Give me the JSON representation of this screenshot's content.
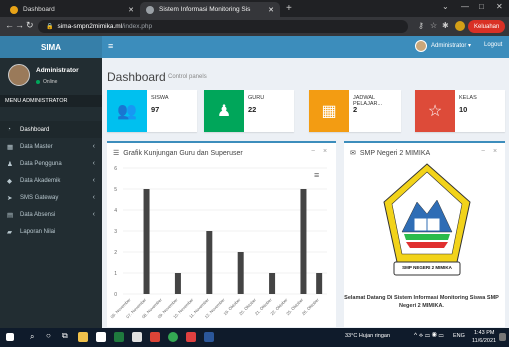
{
  "browser": {
    "tabs": [
      {
        "title": "Dashboard",
        "icon": "globe-icon",
        "active": false
      },
      {
        "title": "Sistem Informasi Monitoring Sis",
        "icon": "globe-icon",
        "active": true
      }
    ],
    "url_host": "sima-smpn2mimika.ml",
    "url_path": "/index.php",
    "profile_label": "Keluahan"
  },
  "header": {
    "logo": "SIMA",
    "user": "Administrator ▾",
    "logout": "Logout"
  },
  "sidebar": {
    "name": "Administrator",
    "status": "Online",
    "menu_header": "MENU ADMINISTRATOR",
    "items": [
      {
        "label": "Dashboard",
        "icon": "dashboard-icon",
        "chevron": false
      },
      {
        "label": "Data Master",
        "icon": "table-icon",
        "chevron": true
      },
      {
        "label": "Data Pengguna",
        "icon": "user-icon",
        "chevron": true
      },
      {
        "label": "Data Akademik",
        "icon": "tag-icon",
        "chevron": true
      },
      {
        "label": "SMS Gateway",
        "icon": "send-icon",
        "chevron": true
      },
      {
        "label": "Data Absensi",
        "icon": "grid-icon",
        "chevron": true
      },
      {
        "label": "Laporan Nilai",
        "icon": "book-icon",
        "chevron": false
      }
    ]
  },
  "content": {
    "title": "Dashboard",
    "subtitle": "Control panels"
  },
  "stats": [
    {
      "label": "SISWA",
      "value": "97",
      "color": "#00c0ef",
      "icon": "users-icon"
    },
    {
      "label": "GURU",
      "value": "22",
      "color": "#00a65a",
      "icon": "user-icon"
    },
    {
      "label": "JADWAL PELAJAR...",
      "value": "2",
      "color": "#f39c12",
      "icon": "calendar-icon"
    },
    {
      "label": "KELAS",
      "value": "10",
      "color": "#dd4b39",
      "icon": "star-icon"
    }
  ],
  "chart_panel": {
    "title": "Grafik Kunjungan Guru dan Superuser",
    "tools": [
      "−",
      "×"
    ]
  },
  "school_panel": {
    "title": "SMP Negeri 2 MIMIKA",
    "tools": [
      "−",
      "×"
    ],
    "logo_text": "SMP NEGERI 2 MIMIKA",
    "welcome": "Selamat Datang Di Sistem Informasi Monitoring Siswa SMP Negeri 2 MIMIKA."
  },
  "chart_data": {
    "type": "bar",
    "categories": [
      "06. November",
      "07. November",
      "08. November",
      "09. November",
      "10. November",
      "11. November",
      "12. November",
      "19. Oktober",
      "20. Oktober",
      "21. Oktober",
      "22. Oktober",
      "25. Oktober",
      "26. Oktober"
    ],
    "values": [
      0,
      5,
      0,
      1,
      0,
      3,
      0,
      2,
      0,
      1,
      0,
      5,
      1
    ],
    "visible_tick_labels": [
      "06. November",
      "07. November",
      "08. November",
      "09. November",
      "10. November",
      "11. November",
      "12. November",
      "19. Oktober",
      "20. Oktober",
      "21. Oktober",
      "22. Oktober",
      "25. Oktober",
      "26. Oktober"
    ],
    "ylim": [
      0,
      6
    ],
    "yticks": [
      0,
      1,
      2,
      3,
      4,
      5,
      6
    ],
    "bar_color": "#444444",
    "grid": true
  },
  "taskbar": {
    "weather": "33°C  Hujan ringan",
    "lang": "ENG",
    "time": "1:43 PM",
    "date": "11/6/2021"
  }
}
